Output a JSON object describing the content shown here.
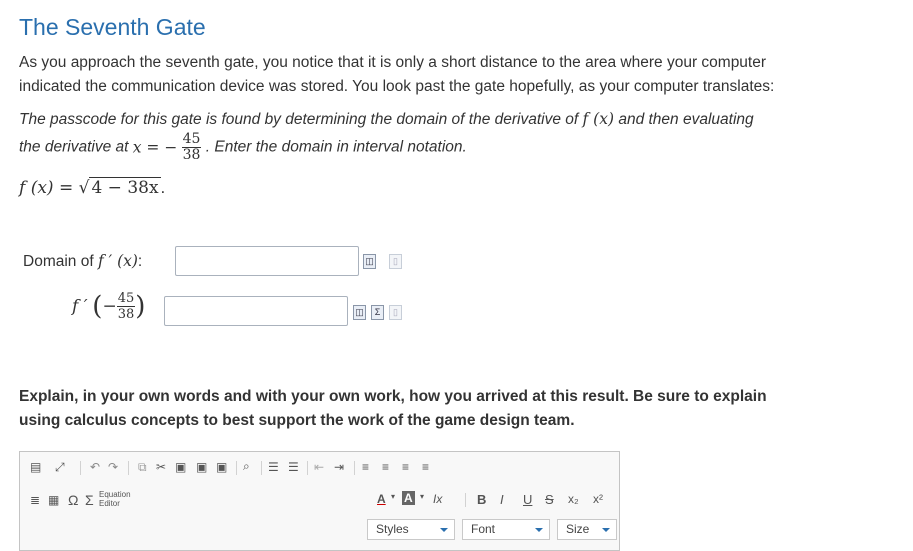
{
  "title": "The Seventh Gate",
  "intro_line1": "As you approach the seventh gate, you notice that it is only a short distance to the area where your computer",
  "intro_line2": "indicated the communication device was stored. You look past the gate hopefully, as your computer translates:",
  "passcode_line1": "The passcode for this gate is found by determining the domain of the derivative of",
  "passcode_line1_fx": "f (x)",
  "passcode_line1_end": "and then evaluating",
  "passcode_line2_start": "the derivative at",
  "passcode_line2_eq": "x = −",
  "frac_num": "45",
  "frac_den": "38",
  "passcode_line2_end": ". Enter the domain in interval notation.",
  "function_lhs": "f (x) = ",
  "function_rhs": "4 − 38x",
  "function_end": ".",
  "domain_label_text": "Domain of",
  "domain_label_math": "f ′ (x)",
  "domain_label_colon": ":",
  "deriv_label": "f ′",
  "deriv_arg_num": "45",
  "deriv_arg_den": "38",
  "explain_line1": "Explain, in your own words and with your own work, how you arrived at this result. Be sure to explain",
  "explain_line2": "using calculus concepts to best support the work of the game design team.",
  "editor": {
    "equation_editor_label1": "Equation",
    "equation_editor_label2": "Editor",
    "omega": "Ω",
    "sigma": "Σ",
    "font_color": "A",
    "bg_color": "A",
    "clear_format": "Ix",
    "bold": "B",
    "italic": "I",
    "underline": "U",
    "strike": "S",
    "sub": "x₂",
    "sup": "x²",
    "styles": "Styles",
    "font": "Font",
    "size": "Size"
  }
}
